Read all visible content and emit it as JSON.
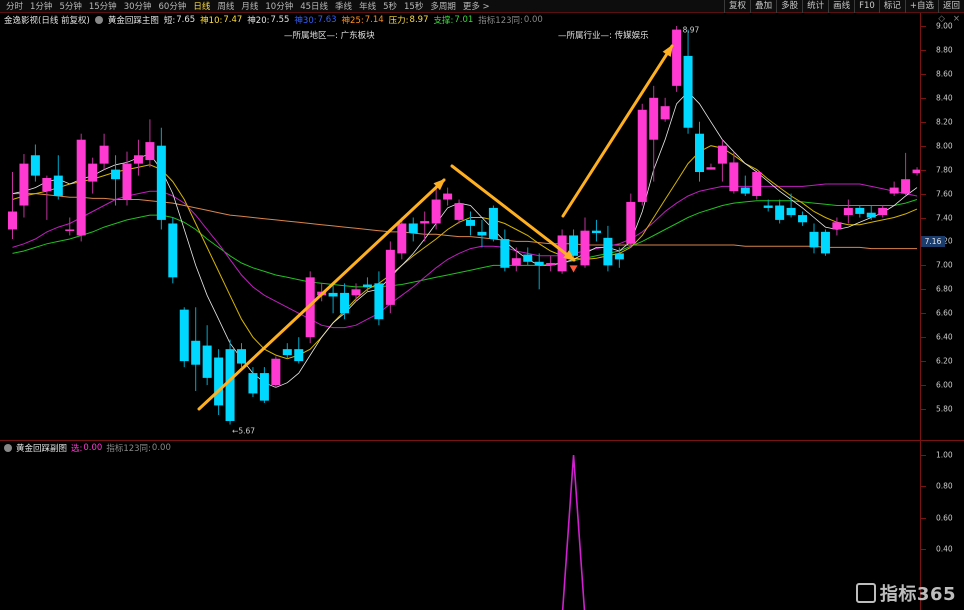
{
  "toolbar": {
    "periods": [
      "分时",
      "1分钟",
      "5分钟",
      "15分钟",
      "30分钟",
      "60分钟",
      "日线",
      "周线",
      "月线",
      "10分钟",
      "45日线",
      "季线",
      "年线",
      "5秒",
      "15秒",
      "多周期",
      "更多 >"
    ],
    "active_period": "日线",
    "right_buttons": [
      "复权",
      "叠加",
      "多股",
      "统计",
      "画线",
      "F10",
      "标记",
      "+自选",
      "返回"
    ]
  },
  "info": {
    "stock": "金逸影视(日线 前复权)",
    "indicator": "黄金回踩主图",
    "short_label": "短:",
    "short_val": "7.65",
    "mid1_label": "神10:",
    "mid1_val": "7.47",
    "mid2_label": "神20:",
    "mid2_val": "7.55",
    "mid3_label": "神30:",
    "mid3_val": "7.63",
    "mid4_label": "神25:",
    "mid4_val": "7.14",
    "press_label": "压力:",
    "press_val": "8.97",
    "support_label": "支撑:",
    "support_val": "7.01",
    "index_label": "指标123同:",
    "index_val": "0.00"
  },
  "sectors": {
    "region": "—所属地区—: 广东板块",
    "industry": "—所属行业—: 传媒娱乐"
  },
  "price_axis": {
    "ticks": [
      "9.00",
      "8.80",
      "8.60",
      "8.40",
      "8.20",
      "8.00",
      "7.80",
      "7.60",
      "7.40",
      "7.20",
      "7.00",
      "6.80",
      "6.60",
      "6.40",
      "6.20",
      "6.00",
      "5.80"
    ],
    "current": "7.16"
  },
  "annotations": {
    "low": "←5.67",
    "high": "8.97"
  },
  "indicator_panel": {
    "name": "黄金回踩副图",
    "field1_label": "选:",
    "field1_val": "0.00",
    "field2_label": "指标123同:",
    "field2_val": "0.00",
    "ticks": [
      "1.00",
      "0.80",
      "0.60",
      "0.40"
    ]
  },
  "logo": "指标365",
  "colors": {
    "up": "#ff3ad2",
    "down": "#00d8ff",
    "ma_white": "#e8e8e8",
    "ma_yellow": "#d4b400",
    "ma_magenta": "#c01fbf",
    "ma_green": "#20c020",
    "ma_orange": "#d9844a",
    "arrow": "#ffb020",
    "axis": "#7a1414"
  },
  "chart_data": {
    "type": "candlestick",
    "ylim": [
      5.6,
      9.1
    ],
    "candles": [
      {
        "o": 7.3,
        "h": 7.78,
        "l": 7.22,
        "c": 7.45
      },
      {
        "o": 7.5,
        "h": 7.93,
        "l": 7.4,
        "c": 7.85
      },
      {
        "o": 7.92,
        "h": 8.01,
        "l": 7.7,
        "c": 7.75
      },
      {
        "o": 7.62,
        "h": 7.75,
        "l": 7.38,
        "c": 7.73
      },
      {
        "o": 7.75,
        "h": 7.92,
        "l": 7.55,
        "c": 7.58
      },
      {
        "o": 7.3,
        "h": 7.4,
        "l": 7.25,
        "c": 7.3
      },
      {
        "o": 7.25,
        "h": 8.1,
        "l": 7.2,
        "c": 8.05
      },
      {
        "o": 7.7,
        "h": 7.9,
        "l": 7.6,
        "c": 7.85
      },
      {
        "o": 7.85,
        "h": 8.1,
        "l": 7.8,
        "c": 8.0
      },
      {
        "o": 7.8,
        "h": 7.92,
        "l": 7.5,
        "c": 7.72
      },
      {
        "o": 7.55,
        "h": 7.95,
        "l": 7.5,
        "c": 7.85
      },
      {
        "o": 7.85,
        "h": 8.05,
        "l": 7.75,
        "c": 7.92
      },
      {
        "o": 7.88,
        "h": 8.22,
        "l": 7.82,
        "c": 8.03
      },
      {
        "o": 8.0,
        "h": 8.15,
        "l": 7.3,
        "c": 7.38
      },
      {
        "o": 7.35,
        "h": 7.4,
        "l": 6.85,
        "c": 6.9
      },
      {
        "o": 6.63,
        "h": 6.65,
        "l": 6.15,
        "c": 6.2
      },
      {
        "o": 6.37,
        "h": 6.65,
        "l": 5.95,
        "c": 6.17
      },
      {
        "o": 6.33,
        "h": 6.5,
        "l": 6.0,
        "c": 6.06
      },
      {
        "o": 6.23,
        "h": 6.3,
        "l": 5.75,
        "c": 5.83
      },
      {
        "o": 6.3,
        "h": 6.38,
        "l": 5.67,
        "c": 5.7
      },
      {
        "o": 6.3,
        "h": 6.35,
        "l": 6.15,
        "c": 6.18
      },
      {
        "o": 6.1,
        "h": 6.15,
        "l": 5.9,
        "c": 5.93
      },
      {
        "o": 6.1,
        "h": 6.15,
        "l": 5.85,
        "c": 5.87
      },
      {
        "o": 6.0,
        "h": 6.24,
        "l": 5.98,
        "c": 6.22
      },
      {
        "o": 6.3,
        "h": 6.35,
        "l": 6.22,
        "c": 6.25
      },
      {
        "o": 6.3,
        "h": 6.4,
        "l": 6.18,
        "c": 6.2
      },
      {
        "o": 6.4,
        "h": 6.95,
        "l": 6.35,
        "c": 6.9
      },
      {
        "o": 6.75,
        "h": 6.85,
        "l": 6.7,
        "c": 6.78
      },
      {
        "o": 6.77,
        "h": 6.85,
        "l": 6.6,
        "c": 6.74
      },
      {
        "o": 6.77,
        "h": 6.85,
        "l": 6.55,
        "c": 6.6
      },
      {
        "o": 6.75,
        "h": 6.85,
        "l": 6.7,
        "c": 6.8
      },
      {
        "o": 6.84,
        "h": 6.9,
        "l": 6.78,
        "c": 6.82
      },
      {
        "o": 6.85,
        "h": 6.95,
        "l": 6.5,
        "c": 6.55
      },
      {
        "o": 6.67,
        "h": 7.2,
        "l": 6.6,
        "c": 7.13
      },
      {
        "o": 7.1,
        "h": 7.4,
        "l": 7.05,
        "c": 7.35
      },
      {
        "o": 7.35,
        "h": 7.4,
        "l": 7.2,
        "c": 7.27
      },
      {
        "o": 7.35,
        "h": 7.45,
        "l": 7.2,
        "c": 7.37
      },
      {
        "o": 7.35,
        "h": 7.65,
        "l": 7.3,
        "c": 7.55
      },
      {
        "o": 7.55,
        "h": 7.65,
        "l": 7.5,
        "c": 7.6
      },
      {
        "o": 7.38,
        "h": 7.55,
        "l": 7.35,
        "c": 7.52
      },
      {
        "o": 7.38,
        "h": 7.45,
        "l": 7.25,
        "c": 7.33
      },
      {
        "o": 7.28,
        "h": 7.38,
        "l": 7.15,
        "c": 7.25
      },
      {
        "o": 7.48,
        "h": 7.5,
        "l": 7.2,
        "c": 7.22
      },
      {
        "o": 7.22,
        "h": 7.3,
        "l": 6.95,
        "c": 6.98
      },
      {
        "o": 7.0,
        "h": 7.15,
        "l": 6.95,
        "c": 7.06
      },
      {
        "o": 7.09,
        "h": 7.15,
        "l": 7.0,
        "c": 7.03
      },
      {
        "o": 7.03,
        "h": 7.1,
        "l": 6.8,
        "c": 7.0
      },
      {
        "o": 7.0,
        "h": 7.08,
        "l": 6.95,
        "c": 7.02
      },
      {
        "o": 6.95,
        "h": 7.3,
        "l": 6.93,
        "c": 7.25
      },
      {
        "o": 7.25,
        "h": 7.3,
        "l": 7.05,
        "c": 7.08
      },
      {
        "o": 7.0,
        "h": 7.4,
        "l": 6.98,
        "c": 7.29
      },
      {
        "o": 7.29,
        "h": 7.38,
        "l": 7.2,
        "c": 7.27
      },
      {
        "o": 7.23,
        "h": 7.33,
        "l": 6.95,
        "c": 7.0
      },
      {
        "o": 7.1,
        "h": 7.15,
        "l": 6.98,
        "c": 7.05
      },
      {
        "o": 7.18,
        "h": 7.6,
        "l": 7.15,
        "c": 7.53
      },
      {
        "o": 7.53,
        "h": 8.35,
        "l": 7.5,
        "c": 8.3
      },
      {
        "o": 8.05,
        "h": 8.5,
        "l": 7.7,
        "c": 8.4
      },
      {
        "o": 8.22,
        "h": 8.4,
        "l": 8.2,
        "c": 8.33
      },
      {
        "o": 8.5,
        "h": 9.0,
        "l": 8.45,
        "c": 8.97
      },
      {
        "o": 8.75,
        "h": 8.97,
        "l": 8.1,
        "c": 8.15
      },
      {
        "o": 8.1,
        "h": 8.2,
        "l": 7.7,
        "c": 7.78
      },
      {
        "o": 7.8,
        "h": 7.85,
        "l": 7.8,
        "c": 7.82
      },
      {
        "o": 7.85,
        "h": 8.05,
        "l": 7.7,
        "c": 8.0
      },
      {
        "o": 7.62,
        "h": 7.95,
        "l": 7.6,
        "c": 7.86
      },
      {
        "o": 7.65,
        "h": 7.75,
        "l": 7.58,
        "c": 7.6
      },
      {
        "o": 7.58,
        "h": 7.75,
        "l": 7.55,
        "c": 7.78
      },
      {
        "o": 7.5,
        "h": 7.55,
        "l": 7.45,
        "c": 7.48
      },
      {
        "o": 7.5,
        "h": 7.55,
        "l": 7.35,
        "c": 7.38
      },
      {
        "o": 7.48,
        "h": 7.6,
        "l": 7.4,
        "c": 7.42
      },
      {
        "o": 7.42,
        "h": 7.45,
        "l": 7.33,
        "c": 7.36
      },
      {
        "o": 7.28,
        "h": 7.35,
        "l": 7.1,
        "c": 7.15
      },
      {
        "o": 7.28,
        "h": 7.3,
        "l": 7.08,
        "c": 7.1
      },
      {
        "o": 7.3,
        "h": 7.4,
        "l": 7.25,
        "c": 7.36
      },
      {
        "o": 7.42,
        "h": 7.55,
        "l": 7.35,
        "c": 7.48
      },
      {
        "o": 7.48,
        "h": 7.5,
        "l": 7.4,
        "c": 7.43
      },
      {
        "o": 7.44,
        "h": 7.5,
        "l": 7.38,
        "c": 7.4
      },
      {
        "o": 7.42,
        "h": 7.5,
        "l": 7.4,
        "c": 7.48
      },
      {
        "o": 7.6,
        "h": 7.7,
        "l": 7.58,
        "c": 7.65
      },
      {
        "o": 7.6,
        "h": 7.94,
        "l": 7.58,
        "c": 7.72
      },
      {
        "o": 7.77,
        "h": 7.82,
        "l": 7.75,
        "c": 7.8
      }
    ],
    "ma_white": [
      7.6,
      7.62,
      7.65,
      7.7,
      7.72,
      7.68,
      7.72,
      7.75,
      7.8,
      7.84,
      7.86,
      7.9,
      7.93,
      7.8,
      7.6,
      7.3,
      7.0,
      6.75,
      6.55,
      6.35,
      6.22,
      6.1,
      6.02,
      5.98,
      6.02,
      6.1,
      6.25,
      6.4,
      6.52,
      6.6,
      6.7,
      6.78,
      6.8,
      6.9,
      7.0,
      7.1,
      7.22,
      7.35,
      7.48,
      7.52,
      7.5,
      7.4,
      7.3,
      7.2,
      7.12,
      7.05,
      7.0,
      7.0,
      7.02,
      7.05,
      7.1,
      7.15,
      7.15,
      7.12,
      7.2,
      7.45,
      7.8,
      8.05,
      8.35,
      8.45,
      8.35,
      8.2,
      8.05,
      7.95,
      7.85,
      7.78,
      7.7,
      7.62,
      7.55,
      7.48,
      7.4,
      7.32,
      7.3,
      7.32,
      7.36,
      7.4,
      7.44,
      7.5,
      7.58,
      7.65
    ],
    "ma_yellow": [
      7.55,
      7.58,
      7.6,
      7.62,
      7.65,
      7.68,
      7.7,
      7.72,
      7.75,
      7.78,
      7.8,
      7.82,
      7.84,
      7.8,
      7.7,
      7.55,
      7.35,
      7.15,
      6.95,
      6.75,
      6.55,
      6.4,
      6.3,
      6.25,
      6.22,
      6.25,
      6.3,
      6.4,
      6.52,
      6.62,
      6.72,
      6.8,
      6.85,
      6.92,
      7.0,
      7.08,
      7.15,
      7.22,
      7.3,
      7.36,
      7.4,
      7.4,
      7.38,
      7.35,
      7.3,
      7.25,
      7.18,
      7.12,
      7.08,
      7.06,
      7.05,
      7.06,
      7.08,
      7.1,
      7.15,
      7.25,
      7.4,
      7.55,
      7.7,
      7.85,
      7.95,
      8.0,
      7.98,
      7.92,
      7.85,
      7.8,
      7.72,
      7.65,
      7.58,
      7.52,
      7.45,
      7.4,
      7.36,
      7.34,
      7.34,
      7.36,
      7.38,
      7.4,
      7.43,
      7.47
    ],
    "ma_magenta": [
      7.15,
      7.18,
      7.22,
      7.28,
      7.32,
      7.35,
      7.4,
      7.45,
      7.5,
      7.55,
      7.58,
      7.6,
      7.62,
      7.62,
      7.58,
      7.52,
      7.42,
      7.3,
      7.18,
      7.05,
      6.92,
      6.82,
      6.75,
      6.7,
      6.65,
      6.6,
      6.55,
      6.5,
      6.48,
      6.48,
      6.5,
      6.55,
      6.6,
      6.68,
      6.75,
      6.82,
      6.9,
      6.98,
      7.05,
      7.1,
      7.14,
      7.16,
      7.16,
      7.15,
      7.12,
      7.1,
      7.08,
      7.08,
      7.08,
      7.1,
      7.12,
      7.14,
      7.16,
      7.18,
      7.22,
      7.28,
      7.36,
      7.45,
      7.52,
      7.58,
      7.62,
      7.64,
      7.66,
      7.66,
      7.66,
      7.66,
      7.66,
      7.66,
      7.66,
      7.66,
      7.67,
      7.68,
      7.68,
      7.68,
      7.68,
      7.66,
      7.64,
      7.62,
      7.6,
      7.58
    ],
    "ma_green": [
      7.1,
      7.12,
      7.15,
      7.18,
      7.2,
      7.22,
      7.25,
      7.28,
      7.32,
      7.35,
      7.38,
      7.4,
      7.42,
      7.42,
      7.4,
      7.36,
      7.3,
      7.22,
      7.15,
      7.08,
      7.02,
      6.98,
      6.95,
      6.92,
      6.9,
      6.88,
      6.86,
      6.85,
      6.84,
      6.83,
      6.82,
      6.82,
      6.82,
      6.83,
      6.84,
      6.86,
      6.88,
      6.9,
      6.92,
      6.94,
      6.96,
      6.98,
      7.0,
      7.0,
      7.0,
      7.0,
      7.0,
      7.01,
      7.02,
      7.04,
      7.06,
      7.08,
      7.1,
      7.12,
      7.16,
      7.2,
      7.25,
      7.3,
      7.35,
      7.4,
      7.44,
      7.47,
      7.5,
      7.52,
      7.53,
      7.54,
      7.54,
      7.54,
      7.54,
      7.53,
      7.52,
      7.51,
      7.5,
      7.5,
      7.5,
      7.5,
      7.5,
      7.5,
      7.52,
      7.55
    ],
    "ma_orange": [
      7.6,
      7.6,
      7.6,
      7.59,
      7.58,
      7.57,
      7.57,
      7.56,
      7.56,
      7.55,
      7.55,
      7.55,
      7.54,
      7.53,
      7.52,
      7.5,
      7.48,
      7.46,
      7.44,
      7.42,
      7.41,
      7.4,
      7.39,
      7.38,
      7.37,
      7.36,
      7.35,
      7.34,
      7.33,
      7.32,
      7.31,
      7.3,
      7.29,
      7.28,
      7.28,
      7.27,
      7.26,
      7.26,
      7.25,
      7.24,
      7.24,
      7.23,
      7.22,
      7.21,
      7.2,
      7.2,
      7.19,
      7.18,
      7.18,
      7.18,
      7.17,
      7.17,
      7.17,
      7.17,
      7.17,
      7.17,
      7.17,
      7.17,
      7.17,
      7.17,
      7.17,
      7.17,
      7.17,
      7.17,
      7.16,
      7.16,
      7.16,
      7.16,
      7.16,
      7.16,
      7.16,
      7.15,
      7.15,
      7.15,
      7.15,
      7.14,
      7.14,
      7.14,
      7.14,
      7.14
    ],
    "signal_index": 49,
    "indicator_values_note": "0 everywhere, peak 1.00 at signal_index"
  }
}
